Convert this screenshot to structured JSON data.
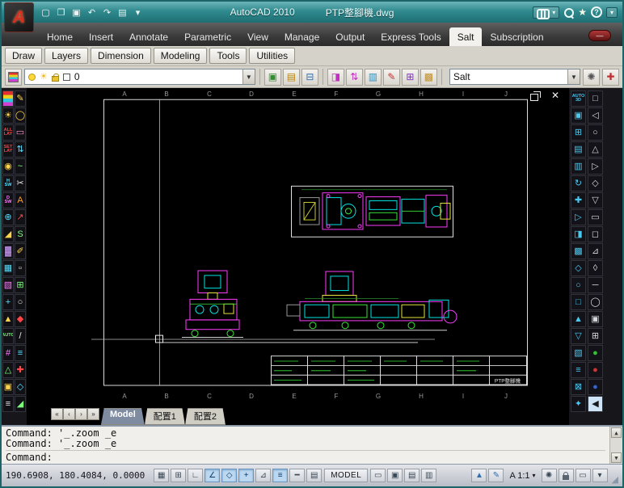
{
  "colors": {
    "titlebar": "#2f8a8e",
    "canvas_bg": "#000000",
    "magenta": "#ff3dff",
    "cyan": "#00e5e5",
    "green": "#39e539",
    "yellow": "#e5e539",
    "active_tab_bg": "#f2f1ed"
  },
  "titlebar": {
    "app_title": "AutoCAD 2010",
    "doc_name": "PTP整腳機.dwg",
    "qat_icons": [
      {
        "n": "new",
        "g": "▢"
      },
      {
        "n": "open",
        "g": "❒"
      },
      {
        "n": "save",
        "g": "▣"
      },
      {
        "n": "undo",
        "g": "↶"
      },
      {
        "n": "redo",
        "g": "↷"
      },
      {
        "n": "plot",
        "g": "▤"
      },
      {
        "n": "menu-down",
        "g": "▾"
      }
    ],
    "info_icons": [
      "binoculars-search",
      "magnifier",
      "star",
      "help",
      "infocenter-minimize"
    ]
  },
  "ribbon": {
    "tabs": [
      {
        "label": "Home"
      },
      {
        "label": "Insert"
      },
      {
        "label": "Annotate"
      },
      {
        "label": "Parametric"
      },
      {
        "label": "View"
      },
      {
        "label": "Manage"
      },
      {
        "label": "Output"
      },
      {
        "label": "Express Tools"
      },
      {
        "label": "Salt",
        "active": true
      },
      {
        "label": "Subscription"
      }
    ],
    "minimize_label": "—"
  },
  "panel_tabs": [
    "Draw",
    "Layers",
    "Dimension",
    "Modeling",
    "Tools",
    "Utilities"
  ],
  "toolbar": {
    "layer_value": "0",
    "salt_value": "Salt",
    "group1": [
      {
        "g": "▣",
        "c": "#2f8f2f"
      },
      {
        "g": "▤",
        "c": "#b8860b"
      },
      {
        "g": "⊟",
        "c": "#2f6fb0"
      }
    ],
    "group2": [
      {
        "g": "◨",
        "c": "#c030c0"
      },
      {
        "g": "⇅",
        "c": "#c030c0"
      },
      {
        "g": "▥",
        "c": "#3090c0"
      },
      {
        "g": "✎",
        "c": "#c03030"
      },
      {
        "g": "⊞",
        "c": "#8030c0"
      },
      {
        "g": "▩",
        "c": "#c09030"
      }
    ],
    "gear_glyph": "✺",
    "extra_glyph": "✚"
  },
  "left_toolbar": {
    "icons": [
      {
        "k": "stripes",
        "n": "layer-colors-tool"
      },
      {
        "t": "✎",
        "c": "#ffd44a"
      },
      {
        "t": "☀",
        "c": "#ffd44a"
      },
      {
        "t": "◯",
        "c": "#ffd44a"
      },
      {
        "t": "ALL LAY",
        "c": "#ff4545",
        "k": "txt",
        "n": "all-lay-tool"
      },
      {
        "t": "▭",
        "c": "#ff9bd0"
      },
      {
        "t": "SET LAY",
        "c": "#ff4545",
        "k": "txt",
        "n": "set-lay-tool"
      },
      {
        "t": "⇅",
        "c": "#55e0ff"
      },
      {
        "t": "◉",
        "c": "#ffd44a"
      },
      {
        "t": "~",
        "c": "#7dff7d"
      },
      {
        "t": "H SW",
        "c": "#55e0ff",
        "k": "txt"
      },
      {
        "t": "✂",
        "c": "#e8e8e8"
      },
      {
        "t": "D SW",
        "c": "#ff7dff",
        "k": "txt"
      },
      {
        "t": "A",
        "c": "#ffa033"
      },
      {
        "t": "⊕",
        "c": "#55e0ff"
      },
      {
        "t": "↗",
        "c": "#ff4545"
      },
      {
        "t": "◢",
        "c": "#ffd44a"
      },
      {
        "t": "S",
        "c": "#7dff7d"
      },
      {
        "t": "▓",
        "c": "#cf9fff"
      },
      {
        "t": "✐",
        "c": "#ffd44a"
      },
      {
        "t": "▦",
        "c": "#55e0ff"
      },
      {
        "t": "▫",
        "c": "#e8e8e8"
      },
      {
        "t": "▧",
        "c": "#ff7dff"
      },
      {
        "t": "⊞",
        "c": "#7dff7d"
      },
      {
        "t": "+",
        "c": "#55e0ff"
      },
      {
        "t": "○",
        "c": "#e8e8e8"
      },
      {
        "t": "▲",
        "c": "#ffd44a"
      },
      {
        "t": "◆",
        "c": "#ff4545"
      },
      {
        "t": "AUTO",
        "c": "#7dff7d",
        "k": "txt",
        "n": "auto-dim-tool"
      },
      {
        "t": "/",
        "c": "#e8e8e8"
      },
      {
        "t": "#",
        "c": "#ff7dff"
      },
      {
        "t": "≡",
        "c": "#55e0ff"
      },
      {
        "t": "△",
        "c": "#7dff7d"
      },
      {
        "t": "✚",
        "c": "#ff4545"
      },
      {
        "t": "▣",
        "c": "#ffd44a"
      },
      {
        "t": "◇",
        "c": "#55e0ff"
      },
      {
        "t": "≡",
        "c": "#e8e8e8"
      },
      {
        "t": "◢",
        "c": "#7dff7d"
      }
    ]
  },
  "right_toolbar": {
    "col1": [
      {
        "t": "AUTO 3D",
        "c": "#49c8f0",
        "k": "txt",
        "n": "auto-3d-tool"
      },
      {
        "t": "▣",
        "c": "#49c8f0"
      },
      {
        "t": "⊞",
        "c": "#49c8f0"
      },
      {
        "t": "▤",
        "c": "#49c8f0"
      },
      {
        "t": "▥",
        "c": "#49c8f0"
      },
      {
        "t": "↻",
        "c": "#49c8f0"
      },
      {
        "t": "✚",
        "c": "#49c8f0"
      },
      {
        "t": "▷",
        "c": "#49c8f0"
      },
      {
        "t": "◨",
        "c": "#49c8f0"
      },
      {
        "t": "▩",
        "c": "#49c8f0"
      },
      {
        "t": "◇",
        "c": "#49c8f0"
      },
      {
        "t": "○",
        "c": "#49c8f0"
      },
      {
        "t": "□",
        "c": "#49c8f0"
      },
      {
        "t": "▲",
        "c": "#49c8f0"
      },
      {
        "t": "▽",
        "c": "#49c8f0"
      },
      {
        "t": "▧",
        "c": "#49c8f0"
      },
      {
        "t": "≡",
        "c": "#49c8f0"
      },
      {
        "t": "⊠",
        "c": "#49c8f0"
      },
      {
        "t": "✦",
        "c": "#49c8f0"
      }
    ],
    "col2": [
      {
        "t": "□",
        "c": "#d5d8dd"
      },
      {
        "t": "◁",
        "c": "#d5d8dd"
      },
      {
        "t": "○",
        "c": "#d5d8dd"
      },
      {
        "t": "△",
        "c": "#d5d8dd"
      },
      {
        "t": "▷",
        "c": "#d5d8dd"
      },
      {
        "t": "◇",
        "c": "#d5d8dd"
      },
      {
        "t": "▽",
        "c": "#d5d8dd"
      },
      {
        "t": "▭",
        "c": "#d5d8dd"
      },
      {
        "t": "◻",
        "c": "#d5d8dd"
      },
      {
        "t": "⊿",
        "c": "#d5d8dd"
      },
      {
        "t": "◊",
        "c": "#d5d8dd"
      },
      {
        "t": "─",
        "c": "#d5d8dd"
      },
      {
        "t": "◯",
        "c": "#d5d8dd"
      },
      {
        "t": "▣",
        "c": "#d5d8dd"
      },
      {
        "t": "⊞",
        "c": "#d5d8dd"
      },
      {
        "t": "●",
        "c": "#35c035"
      },
      {
        "t": "●",
        "c": "#d03535"
      },
      {
        "t": "●",
        "c": "#3565d0"
      },
      {
        "t": "◀",
        "c": "#15181c",
        "b": "#cfe3f6"
      }
    ]
  },
  "canvas": {
    "ruler_letters": [
      "A",
      "B",
      "C",
      "D",
      "E",
      "F",
      "G",
      "H",
      "I",
      "J"
    ],
    "title_block_name": "PTP整腳機"
  },
  "layout_bar": {
    "arrows": [
      "«",
      "‹",
      "›",
      "»"
    ],
    "tabs": [
      {
        "label": "Model",
        "active": true
      },
      {
        "label": "配置1"
      },
      {
        "label": "配置2"
      }
    ]
  },
  "command": {
    "lines": [
      "Command: '_.zoom _e",
      "Command: '_.zoom _e"
    ],
    "prompt": "Command:"
  },
  "status": {
    "coords": "190.6908, 180.4084, 0.0000",
    "toggles": [
      {
        "name": "snap",
        "g": "▦",
        "on": false
      },
      {
        "name": "grid",
        "g": "⊞",
        "on": false
      },
      {
        "name": "ortho",
        "g": "∟",
        "on": false
      },
      {
        "name": "polar",
        "g": "∠",
        "on": true
      },
      {
        "name": "osnap",
        "g": "◇",
        "on": true
      },
      {
        "name": "otrack",
        "g": "+",
        "on": true
      },
      {
        "name": "ducs",
        "g": "⊿",
        "on": false
      },
      {
        "name": "dyn",
        "g": "≡",
        "on": true
      },
      {
        "name": "lwt",
        "g": "━",
        "on": false
      },
      {
        "name": "qp",
        "g": "▤",
        "on": false
      }
    ],
    "model_label": "MODEL",
    "mid_icons": [
      {
        "n": "layout-model",
        "g": "▭"
      },
      {
        "n": "layout-1",
        "g": "▣"
      },
      {
        "n": "quick-view-drawings",
        "g": "▤"
      },
      {
        "n": "quick-view-layouts",
        "g": "▥"
      }
    ],
    "right_icons": [
      {
        "n": "annotation-visibility",
        "g": "▲",
        "c": "#2f6fb0"
      },
      {
        "n": "annotation-autoscale",
        "g": "✎",
        "c": "#2f6fb0"
      }
    ],
    "scale": "A 1:1",
    "right_icons2": [
      {
        "n": "workspace-gear",
        "g": "✺"
      },
      {
        "n": "toolbar-lock",
        "lock": true
      },
      {
        "n": "clean-screen",
        "g": "▭"
      },
      {
        "n": "status-menu-down",
        "g": "▾"
      }
    ]
  }
}
